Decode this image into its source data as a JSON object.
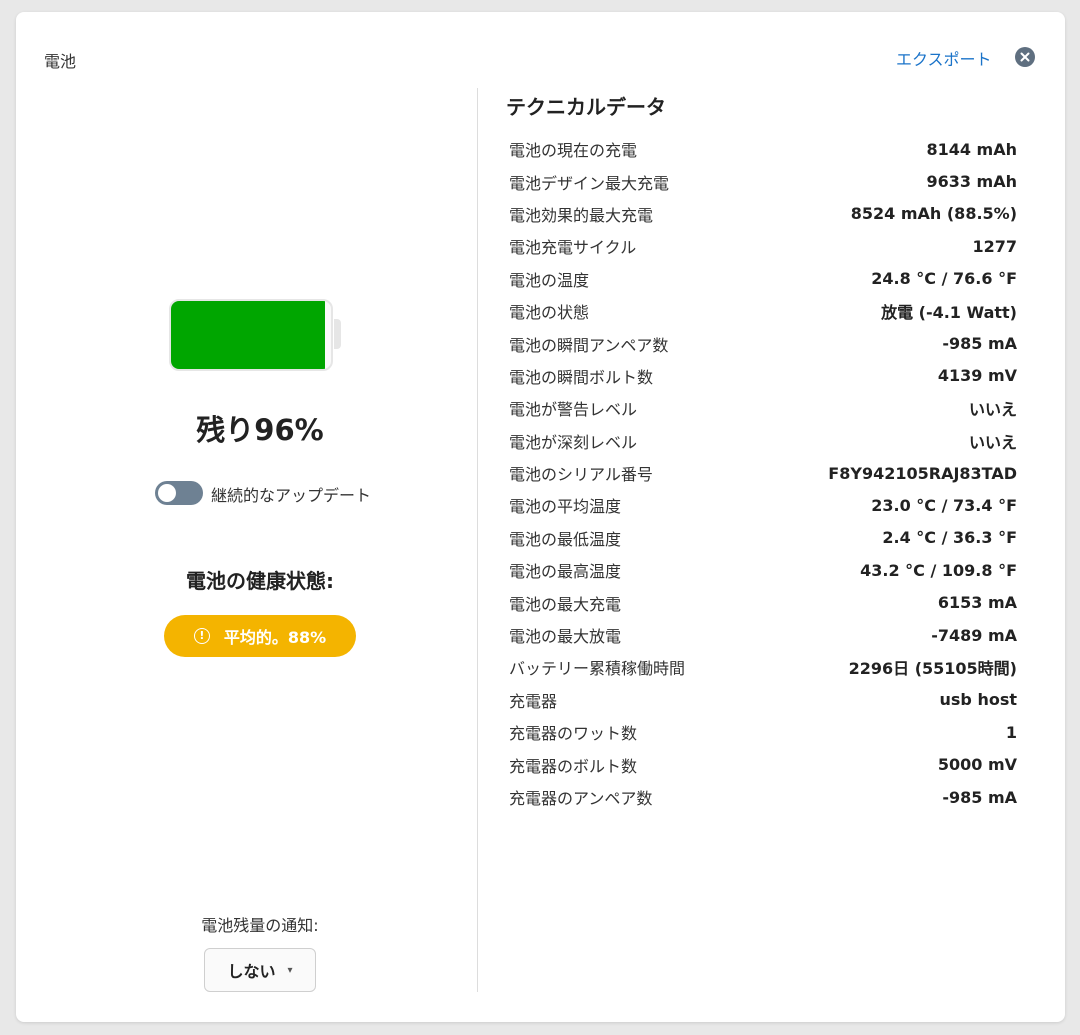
{
  "window": {
    "title": "電池",
    "export_label": "エクスポート",
    "close_icon": "close-circle-icon"
  },
  "battery": {
    "level_percent": 96,
    "fill_color": "#00a600",
    "remaining_text": "残り96%"
  },
  "continuous_update": {
    "label": "継続的なアップデート",
    "enabled": false
  },
  "health": {
    "title": "電池の健康状態:",
    "badge_icon": "warning-circle-icon",
    "badge_text": "平均的。88%",
    "badge_color": "#f4b400"
  },
  "notification": {
    "label": "電池残量の通知:",
    "selected": "しない"
  },
  "technical": {
    "title": "テクニカルデータ",
    "rows": [
      {
        "label": "電池の現在の充電",
        "value": "8144 mAh"
      },
      {
        "label": "電池デザイン最大充電",
        "value": "9633 mAh"
      },
      {
        "label": "電池効果的最大充電",
        "value": "8524 mAh (88.5%)"
      },
      {
        "label": "電池充電サイクル",
        "value": "1277"
      },
      {
        "label": "電池の温度",
        "value": "24.8 °C / 76.6 °F"
      },
      {
        "label": "電池の状態",
        "value": "放電 (-4.1 Watt)"
      },
      {
        "label": "電池の瞬間アンペア数",
        "value": "-985 mA"
      },
      {
        "label": "電池の瞬間ボルト数",
        "value": "4139 mV"
      },
      {
        "label": "電池が警告レベル",
        "value": "いいえ"
      },
      {
        "label": "電池が深刻レベル",
        "value": "いいえ"
      },
      {
        "label": "電池のシリアル番号",
        "value": "F8Y942105RAJ83TAD"
      },
      {
        "label": "電池の平均温度",
        "value": "23.0 °C / 73.4 °F"
      },
      {
        "label": "電池の最低温度",
        "value": "2.4 °C / 36.3 °F"
      },
      {
        "label": "電池の最高温度",
        "value": "43.2 °C / 109.8 °F"
      },
      {
        "label": "電池の最大充電",
        "value": "6153 mA"
      },
      {
        "label": "電池の最大放電",
        "value": "-7489 mA"
      },
      {
        "label": "バッテリー累積稼働時間",
        "value": "2296日 (55105時間)"
      },
      {
        "label": "充電器",
        "value": "usb host"
      },
      {
        "label": "充電器のワット数",
        "value": "1"
      },
      {
        "label": "充電器のボルト数",
        "value": "5000 mV"
      },
      {
        "label": "充電器のアンペア数",
        "value": "-985 mA"
      }
    ]
  }
}
